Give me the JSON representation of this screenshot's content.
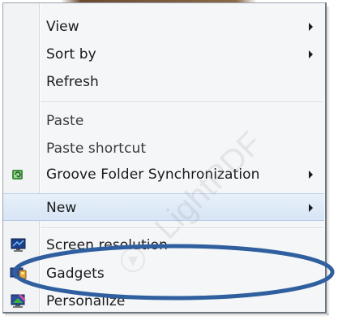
{
  "menu": {
    "items": [
      {
        "label": "View",
        "has_submenu": true
      },
      {
        "label": "Sort by",
        "has_submenu": true
      },
      {
        "label": "Refresh",
        "has_submenu": false
      },
      {
        "label": "Paste",
        "has_submenu": false
      },
      {
        "label": "Paste shortcut",
        "has_submenu": false
      },
      {
        "label": "Groove Folder Synchronization",
        "has_submenu": true,
        "icon": "groove-sync-icon"
      },
      {
        "label": "New",
        "has_submenu": true
      },
      {
        "label": "Screen resolution",
        "has_submenu": false,
        "icon": "monitor-icon"
      },
      {
        "label": "Gadgets",
        "has_submenu": false,
        "icon": "gadgets-icon"
      },
      {
        "label": "Personalize",
        "has_submenu": false,
        "icon": "personalize-icon"
      }
    ]
  },
  "watermark": {
    "text": "LightPDF"
  },
  "colors": {
    "highlight_ellipse": "#2f5f9e",
    "menu_background": "#f4f6f8",
    "gutter": "#f1f3f5",
    "text": "#1a1a1a"
  }
}
